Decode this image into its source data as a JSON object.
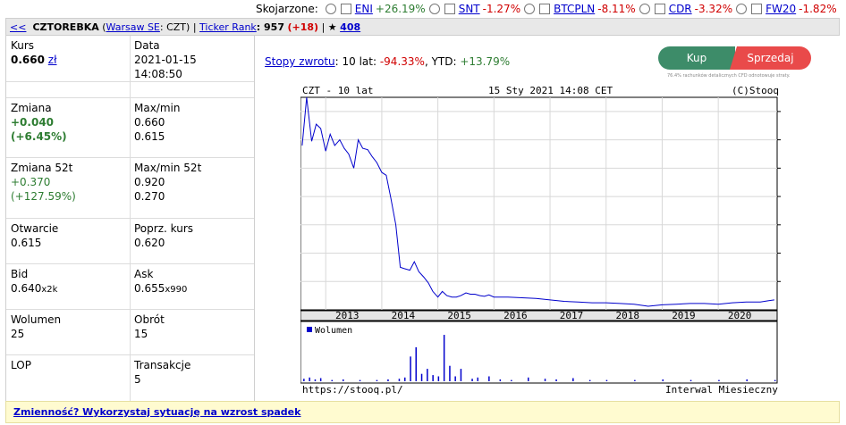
{
  "compare": {
    "label": "Skojarzone:",
    "items": [
      {
        "name": "ENI",
        "change": "+26.19%",
        "dir": "pos"
      },
      {
        "name": "SNT",
        "change": "-1.27%",
        "dir": "neg"
      },
      {
        "name": "BTCPLN",
        "change": "-8.11%",
        "dir": "neg"
      },
      {
        "name": "CDR",
        "change": "-3.32%",
        "dir": "neg"
      },
      {
        "name": "FW20",
        "change": "-1.82%",
        "dir": "neg"
      }
    ]
  },
  "header": {
    "back": "<<",
    "name": "CZTOREBKA",
    "exchange": "Warsaw SE",
    "ticker": ": CZT)",
    "open_paren": "(",
    "sep": "|",
    "rank_label": "Ticker Rank",
    "rank_value": ": 957",
    "rank_change": "(+18)",
    "sep2": "|",
    "star": "★",
    "star_count": "408"
  },
  "quote": {
    "kurs_label": "Kurs",
    "kurs_value": "0.660",
    "kurs_unit": "zł",
    "data_label": "Data",
    "data_date": "2021-01-15",
    "data_time": "14:08:50",
    "zmiana_label": "Zmiana",
    "zmiana_abs": "+0.040",
    "zmiana_pct": "(+6.45%)",
    "maxmin_label": "Max/min",
    "max": "0.660",
    "min": "0.615",
    "zmiana52_label": "Zmiana 52t",
    "zmiana52_abs": "+0.370",
    "zmiana52_pct": "(+127.59%)",
    "maxmin52_label": "Max/min 52t",
    "max52": "0.920",
    "min52": "0.270",
    "otwarcie_label": "Otwarcie",
    "otwarcie": "0.615",
    "poprz_label": "Poprz. kurs",
    "poprz": "0.620",
    "bid_label": "Bid",
    "bid": "0.640",
    "bid_size": "x2k",
    "ask_label": "Ask",
    "ask": "0.655",
    "ask_size": "x990",
    "wolumen_label": "Wolumen",
    "wolumen": "25",
    "obrot_label": "Obrót",
    "obrot": "15",
    "lop_label": "LOP",
    "lop": "",
    "transakcje_label": "Transakcje",
    "transakcje": "5"
  },
  "returns": {
    "link": "Stopy zwrotu",
    "period": ": 10 lat: ",
    "value10y": "-94.33%",
    "ytd_label": ", YTD: ",
    "ytd": "+13.79%"
  },
  "trade": {
    "buy": "Kup",
    "sell": "Sprzedaj",
    "disclaimer": "76.4% rachunków detalicznych CFD odnotowuje straty."
  },
  "banner": {
    "text": "Zmienność? Wykorzystaj sytuację na wzrost spadek"
  },
  "chart_data": {
    "type": "line",
    "title": "CZT - 10 lat",
    "date_label": "15 Sty 2021 14:08 CET",
    "copyright": "(C)Stooq",
    "source": "https://stooq.pl/",
    "interval": "Interwal Miesieczny",
    "volume_legend": "Wolumen",
    "ylim": [
      0,
      15
    ],
    "yticks": [
      2,
      4,
      6,
      8,
      10,
      12,
      14
    ],
    "xlim": [
      2012.55,
      2021.05
    ],
    "xticks": [
      2013,
      2014,
      2015,
      2016,
      2017,
      2018,
      2019,
      2020
    ],
    "line_color": "#0000cc",
    "x": [
      2012.58,
      2012.66,
      2012.75,
      2012.83,
      2012.91,
      2013.0,
      2013.08,
      2013.16,
      2013.25,
      2013.33,
      2013.41,
      2013.5,
      2013.58,
      2013.66,
      2013.75,
      2013.83,
      2013.91,
      2014.0,
      2014.08,
      2014.16,
      2014.25,
      2014.33,
      2014.41,
      2014.5,
      2014.58,
      2014.66,
      2014.75,
      2014.83,
      2014.91,
      2015.0,
      2015.08,
      2015.16,
      2015.25,
      2015.33,
      2015.41,
      2015.5,
      2015.58,
      2015.66,
      2015.75,
      2015.83,
      2015.91,
      2016.0,
      2016.25,
      2016.5,
      2016.75,
      2017.0,
      2017.25,
      2017.5,
      2017.75,
      2018.0,
      2018.25,
      2018.5,
      2018.75,
      2019.0,
      2019.25,
      2019.5,
      2019.75,
      2020.0,
      2020.25,
      2020.5,
      2020.75,
      2020.9,
      2021.0
    ],
    "values": [
      11.6,
      15.0,
      11.9,
      13.1,
      12.8,
      11.2,
      12.4,
      11.6,
      12.0,
      11.4,
      11.0,
      10.0,
      12.0,
      11.4,
      11.3,
      10.8,
      10.4,
      9.7,
      9.5,
      7.9,
      6.0,
      3.0,
      2.9,
      2.8,
      3.4,
      2.7,
      2.3,
      1.9,
      1.3,
      0.9,
      1.3,
      1.0,
      0.9,
      0.9,
      1.0,
      1.2,
      1.1,
      1.1,
      1.0,
      0.95,
      1.05,
      0.9,
      0.9,
      0.85,
      0.8,
      0.7,
      0.6,
      0.55,
      0.5,
      0.5,
      0.45,
      0.4,
      0.25,
      0.35,
      0.4,
      0.45,
      0.45,
      0.4,
      0.5,
      0.55,
      0.55,
      0.65,
      0.7
    ],
    "volume_x": [
      2012.6,
      2012.7,
      2012.8,
      2012.9,
      2013.1,
      2013.3,
      2013.6,
      2013.9,
      2014.1,
      2014.3,
      2014.4,
      2014.5,
      2014.6,
      2014.7,
      2014.8,
      2014.9,
      2015.0,
      2015.1,
      2015.2,
      2015.3,
      2015.4,
      2015.6,
      2015.7,
      2015.9,
      2016.1,
      2016.3,
      2016.6,
      2016.9,
      2017.1,
      2017.4,
      2017.7,
      2018.0,
      2018.5,
      2019.0,
      2019.5,
      2020.0,
      2020.5,
      2021.0
    ],
    "volume_values": [
      4,
      6,
      3,
      5,
      2,
      3,
      2,
      2,
      3,
      4,
      6,
      40,
      55,
      12,
      20,
      10,
      8,
      75,
      25,
      8,
      20,
      4,
      6,
      8,
      3,
      2,
      6,
      4,
      3,
      5,
      2,
      2,
      2,
      3,
      2,
      2,
      3,
      2
    ]
  }
}
